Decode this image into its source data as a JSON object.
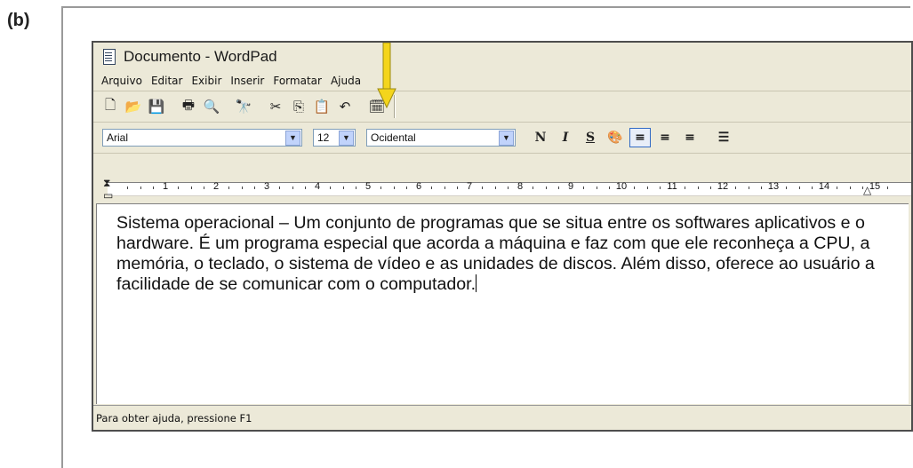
{
  "figure_label": "(b)",
  "window": {
    "title": "Documento - WordPad"
  },
  "menu": [
    "Arquivo",
    "Editar",
    "Exibir",
    "Inserir",
    "Formatar",
    "Ajuda"
  ],
  "toolbar": {
    "buttons": [
      {
        "name": "new-icon",
        "glyph": "🗋"
      },
      {
        "name": "open-icon",
        "glyph": "📂"
      },
      {
        "name": "save-icon",
        "glyph": "💾"
      },
      {
        "name": "print-icon",
        "glyph": "🖶"
      },
      {
        "name": "print-preview-icon",
        "glyph": "🔍"
      },
      {
        "name": "find-icon",
        "glyph": "🔭"
      },
      {
        "name": "cut-icon",
        "glyph": "✂"
      },
      {
        "name": "copy-icon",
        "glyph": "⎘"
      },
      {
        "name": "paste-icon",
        "glyph": "📋"
      },
      {
        "name": "undo-icon",
        "glyph": "↶"
      },
      {
        "name": "date-time-icon",
        "glyph": "🗓"
      }
    ]
  },
  "format_bar": {
    "font": "Arial",
    "size": "12",
    "script": "Ocidental",
    "bold": "N",
    "italic": "I",
    "underline": "S",
    "color_icon": "🎨",
    "align_left": "≡",
    "align_center": "≡",
    "align_right": "≡",
    "bullets": "☰"
  },
  "ruler": {
    "numbers": [
      "1",
      "2",
      "3",
      "4",
      "5",
      "6",
      "7",
      "8",
      "9",
      "10",
      "11",
      "12",
      "13",
      "14",
      "15"
    ]
  },
  "document": {
    "text": "Sistema operacional – Um conjunto de programas que se situa entre os softwares aplicativos e o hardware. É um programa especial que acorda a máquina e faz com que ele reconheça a CPU, a memória, o teclado, o sistema de vídeo e as unidades de discos. Além disso, oferece ao usuário a facilidade de se comunicar com o computador."
  },
  "status": {
    "text": "Para obter ajuda, pressione F1"
  },
  "colors": {
    "annotation_arrow": "#f4d51c",
    "window_bg": "#ece9d8",
    "combo_arrow_bg": "#c1d3fb"
  }
}
